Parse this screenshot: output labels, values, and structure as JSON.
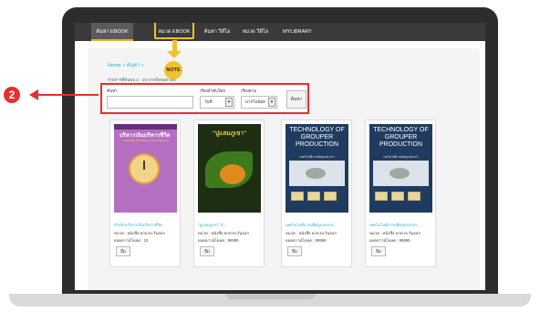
{
  "nav": {
    "items": [
      "ค้นหา EBOOK",
      "หมวด EBOOK",
      "ค้นหา วีดีโอ",
      "หมวด วีดีโอ",
      "MYLIBRARY"
    ]
  },
  "note_label": "NOTE",
  "step_number": "2",
  "breadcrumb": "Home » ค้นหา »",
  "results_text": "รายการที่ค้นพบ 1 - 20 จากทั้งหมด 999",
  "search": {
    "keyword_label": "ค้นหา",
    "sort_label": "เรียงลำดับโดย",
    "sort_value": "วันที่",
    "order_label": "เรียงตาม",
    "order_value": "มากไปน้อย",
    "search_button": "ค้นหา"
  },
  "books": [
    {
      "title": "สำหรับบริหารเงินบริหารชีวิต",
      "category": "หมวด : หนังสือ ยกท.ตะวันออก",
      "downloads": "ยอดดาวน์โหลด : 10",
      "button": "ยืม",
      "cover_title": "บริหารเงินบริหารชีวิต",
      "cover_subtitle": "Financial, Planning and Life Planning"
    },
    {
      "title": "\"ปูแสมภูเขา\" มี...",
      "category": "หมวด : หนังสือ ยกท.ตะวันออก",
      "downloads": "ยอดดาวน์โหลด : 99999",
      "button": "ยืม",
      "cover_title": "\"ปูแสมภูเขา\""
    },
    {
      "title": "เทคโนโลยีการผลิตลูกปลาเก...",
      "category": "หมวด : หนังสือ ยกท.ตะวันออก",
      "downloads": "ยอดดาวน์โหลด : 99999",
      "button": "ยืม",
      "cover_title": "TECHNOLOGY OF GROUPER PRODUCTION",
      "cover_subtitle": "เทคโนโลยีการผลิตลูกปลาเก๋า"
    },
    {
      "title": "เทคโนโลยีการผลิตลูกปลาเก...",
      "category": "หมวด : หนังสือ ยกท.ตะวันออก",
      "downloads": "ยอดดาวน์โหลด : 99999",
      "button": "ยืม",
      "cover_title": "TECHNOLOGY OF GROUPER PRODUCTION",
      "cover_subtitle": "เทคโนโลยีการผลิตลูกปลาเก๋า"
    }
  ],
  "colors": {
    "highlight_box": "#e53030",
    "note_yellow": "#f2c12e",
    "link_teal": "#2ab0c8",
    "nav_bg": "#3a3a3a"
  }
}
